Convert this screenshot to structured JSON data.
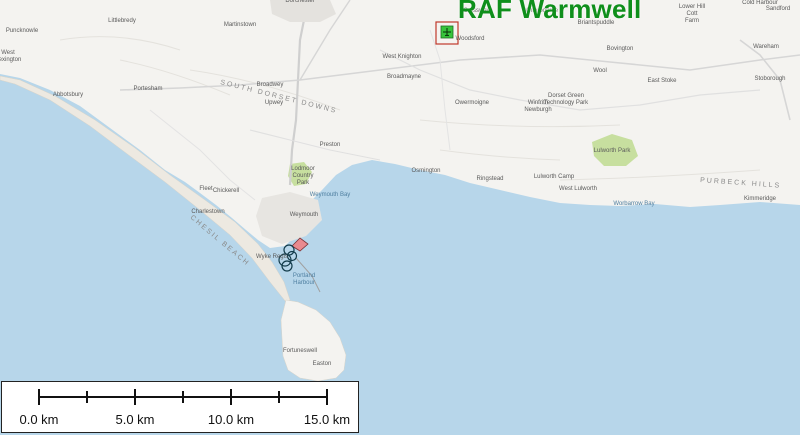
{
  "map": {
    "title": "RAF Warmwell",
    "places": [
      {
        "id": "littlebredy",
        "label": "Littlebredy"
      },
      {
        "id": "martinstown",
        "label": "Martinstown"
      },
      {
        "id": "puncknowle",
        "label": "Puncknowle"
      },
      {
        "id": "west-bexington",
        "label": "West\nBexington"
      },
      {
        "id": "abbotsbury",
        "label": "Abbotsbury"
      },
      {
        "id": "portesham",
        "label": "Portesham"
      },
      {
        "id": "crossways",
        "label": "Crossways"
      },
      {
        "id": "woodsford",
        "label": "Woodsford"
      },
      {
        "id": "briantspuddle",
        "label": "Briantspuddle"
      },
      {
        "id": "west-knighton",
        "label": "West Knighton"
      },
      {
        "id": "broadmayne",
        "label": "Broadmayne"
      },
      {
        "id": "owermoigne",
        "label": "Owermoigne"
      },
      {
        "id": "winfrith",
        "label": "Winfrith\nNewburgh"
      },
      {
        "id": "wool",
        "label": "Wool"
      },
      {
        "id": "east-stoke",
        "label": "East Stoke"
      },
      {
        "id": "wareham",
        "label": "Wareham"
      },
      {
        "id": "stoborough",
        "label": "Stoborough"
      },
      {
        "id": "sandford",
        "label": "Sandford"
      },
      {
        "id": "lulworth-camp",
        "label": "Lulworth Camp"
      },
      {
        "id": "west-lulworth",
        "label": "West Lulworth"
      },
      {
        "id": "lulworth-park",
        "label": "Lulworth Park"
      },
      {
        "id": "preston",
        "label": "Preston"
      },
      {
        "id": "osmington",
        "label": "Osmington"
      },
      {
        "id": "ringstead",
        "label": "Ringstead"
      },
      {
        "id": "chickerell",
        "label": "Chickerell"
      },
      {
        "id": "charlestown",
        "label": "Charlestown"
      },
      {
        "id": "fleet",
        "label": "Fleet"
      },
      {
        "id": "weymouth",
        "label": "Weymouth"
      },
      {
        "id": "lodmoor",
        "label": "Lodmoor\nCountry\nPark"
      },
      {
        "id": "weymouth-bay",
        "label": "Weymouth Bay"
      },
      {
        "id": "portland-harbour",
        "label": "Portland\nHarbour"
      },
      {
        "id": "wyke-regis",
        "label": "Wyke Regis"
      },
      {
        "id": "fortuneswell",
        "label": "Fortuneswell"
      },
      {
        "id": "easton",
        "label": "Easton"
      },
      {
        "id": "winfrith-tech",
        "label": "Dorset Green\nTechnology Park"
      },
      {
        "id": "worbarrow",
        "label": "Worbarrow Bay"
      },
      {
        "id": "kingston",
        "label": "Kimmeridge"
      },
      {
        "id": "upwey",
        "label": "Upwey"
      },
      {
        "id": "broadwey",
        "label": "Broadwey"
      },
      {
        "id": "dorchester",
        "label": "Dorchester"
      },
      {
        "id": "bovington",
        "label": "Bovington"
      },
      {
        "id": "cold-harbour",
        "label": "Cold Harbour"
      },
      {
        "id": "lower-hill",
        "label": "Lower Hill\nCott\nFarm"
      },
      {
        "id": "winterbourne",
        "label": "Winterbourne"
      }
    ],
    "regions": [
      {
        "id": "south-dorset-downs",
        "label": "SOUTH DORSET DOWNS"
      },
      {
        "id": "chesil-beach",
        "label": "CHESIL BEACH"
      },
      {
        "id": "purbeck-hills",
        "label": "PURBECK HILLS"
      }
    ],
    "colors": {
      "sea": "#b7d6ea",
      "land": "#f4f3f0",
      "park": "#c7df9f",
      "marker_fill": "#37c43c",
      "marker_border": "#c0392b",
      "title": "#0f8f1b",
      "site_fill": "#e98a8f"
    },
    "marker_icon": "aircraft-icon"
  },
  "scalebar": {
    "labels": [
      "0.0 km",
      "5.0 km",
      "10.0 km",
      "15.0 km"
    ]
  }
}
